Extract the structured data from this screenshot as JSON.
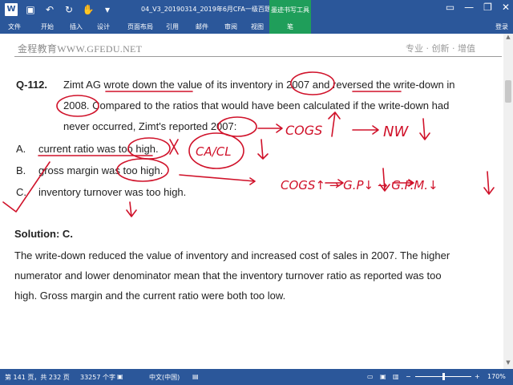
{
  "titlebar": {
    "document_title": "04_V3_20190314_2019年6月CFA一级百题...",
    "context_group": "墨迹书写工具",
    "user": "登录"
  },
  "ribbon": {
    "tabs": [
      "文件",
      "开始",
      "插入",
      "设计",
      "页面布局",
      "引用",
      "邮件",
      "审阅",
      "视图",
      "笔"
    ]
  },
  "header": {
    "left": "金程教育WWW.GFEDU.NET",
    "right": "专业 · 创新 · 增值"
  },
  "question": {
    "number": "Q-112.",
    "line1": "Zimt AG wrote down the value of its inventory in 2007 and reversed the write-down in",
    "line2": "2008. Compared to the ratios that would have been calculated if the write-down had",
    "line3": "never occurred, Zimt's reported 2007:",
    "options": [
      {
        "letter": "A.",
        "text": "current ratio was too high."
      },
      {
        "letter": "B.",
        "text": "gross margin was too high."
      },
      {
        "letter": "C.",
        "text": "inventory turnover was too high."
      }
    ]
  },
  "solution": {
    "label": "Solution: C.",
    "line1": "The write-down reduced the value of inventory and increased cost of sales in 2007. The higher",
    "line2": "numerator and lower denominator mean that the inventory turnover ratio as reported was too",
    "line3": "high. Gross margin and the current ratio were both too low."
  },
  "ink_notes": {
    "cogs": "COGS",
    "nw": "NW",
    "ca_cl": "CA/CL",
    "chain": "COGS↑ → G.P↓ → G.P.M.↓"
  },
  "statusbar": {
    "page": "第 141 页，共 232 页",
    "words": "33257 个字",
    "lang": "中文(中国)",
    "zoom": "170%"
  },
  "colors": {
    "ribbon": "#2b579a",
    "context": "#1f9e5a",
    "ink": "#d0122a"
  }
}
